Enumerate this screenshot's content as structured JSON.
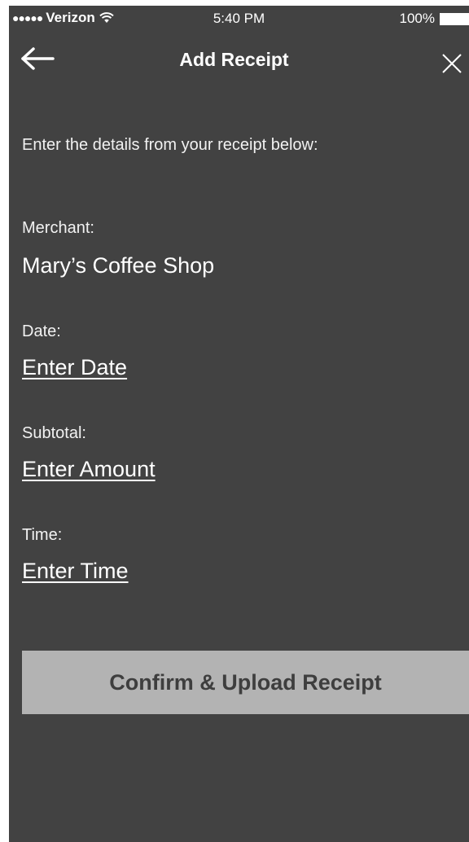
{
  "status_bar": {
    "signal_dots": "●●●●●",
    "carrier": "Verizon",
    "time": "5:40 PM",
    "battery_percent": "100%"
  },
  "nav": {
    "title": "Add Receipt",
    "back_icon": "back-arrow-icon",
    "close_icon": "close-icon"
  },
  "intro": "Enter the details from your receipt below:",
  "fields": {
    "merchant": {
      "label": "Merchant:",
      "value": "Mary’s Coffee Shop"
    },
    "date": {
      "label": "Date:",
      "value": "Enter Date"
    },
    "subtotal": {
      "label": "Subtotal:",
      "value": "Enter Amount"
    },
    "time": {
      "label": "Time:",
      "value": "Enter Time"
    }
  },
  "confirm_button": "Confirm & Upload Receipt",
  "colors": {
    "background": "#424242",
    "button_background": "#b3b3b3",
    "button_text": "#3e3e3e",
    "text": "#ffffff"
  }
}
